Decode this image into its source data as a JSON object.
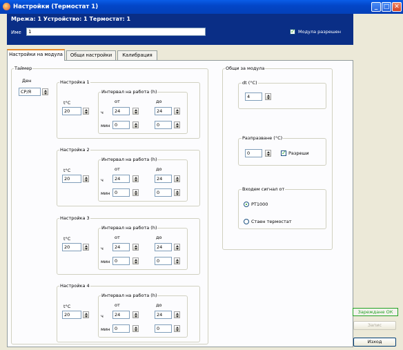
{
  "window": {
    "title": "Настройки (Термостат 1)",
    "minimize": "_",
    "maximize": "□",
    "close": "✕"
  },
  "header": {
    "ids": "Мрежа: 1  Устройство: 1  Термостат: 1",
    "name_label": "Име",
    "name_value": "1",
    "module_enabled_label": "Модула разрешен",
    "module_enabled": true
  },
  "tabs": [
    {
      "label": "Настройки на модула",
      "active": true
    },
    {
      "label": "Общи настройки",
      "active": false
    },
    {
      "label": "Калибрация",
      "active": false
    }
  ],
  "timer": {
    "label": "Таймер",
    "day_label": "Ден",
    "day_value": "СР/Я",
    "settings": [
      {
        "title": "Настройка 1",
        "temp_label": "t°C",
        "temp": "20",
        "interval_label": "Интервал на работа (h)",
        "from_label": "от",
        "to_label": "до",
        "hour_label": "ч",
        "min_label": "мин",
        "from_h": "24",
        "to_h": "24",
        "from_m": "0",
        "to_m": "0"
      },
      {
        "title": "Настройка 2",
        "temp_label": "t°C",
        "temp": "20",
        "interval_label": "Интервал на работа (h)",
        "from_label": "от",
        "to_label": "до",
        "hour_label": "ч",
        "min_label": "мин",
        "from_h": "24",
        "to_h": "24",
        "from_m": "0",
        "to_m": "0"
      },
      {
        "title": "Настройка 3",
        "temp_label": "t°C",
        "temp": "20",
        "interval_label": "Интервал на работа (h)",
        "from_label": "от",
        "to_label": "до",
        "hour_label": "ч",
        "min_label": "мин",
        "from_h": "24",
        "to_h": "24",
        "from_m": "0",
        "to_m": "0"
      },
      {
        "title": "Настройка 4",
        "temp_label": "t°C",
        "temp": "20",
        "interval_label": "Интервал на работа (h)",
        "from_label": "от",
        "to_label": "до",
        "hour_label": "ч",
        "min_label": "мин",
        "from_h": "24",
        "to_h": "24",
        "from_m": "0",
        "to_m": "0"
      }
    ]
  },
  "module_general": {
    "label": "Общи за модула",
    "dt_label": "dt (°C)",
    "dt_value": "4",
    "discharge_label": "Разпрaзване (°C)",
    "discharge_value": "0",
    "allow_label": "Разреши",
    "allow_checked": true,
    "input_label": "Входем сигнал от",
    "input_options": [
      {
        "label": "PT1000",
        "selected": true
      },
      {
        "label": "Стаен термостат",
        "selected": false
      }
    ]
  },
  "side": {
    "status": "Зареждане ОК",
    "write_label": "Запис",
    "exit_label": "Изход"
  },
  "colors": {
    "titlebar": "#0346c8",
    "header": "#0a2e86",
    "ok": "#21a121"
  }
}
